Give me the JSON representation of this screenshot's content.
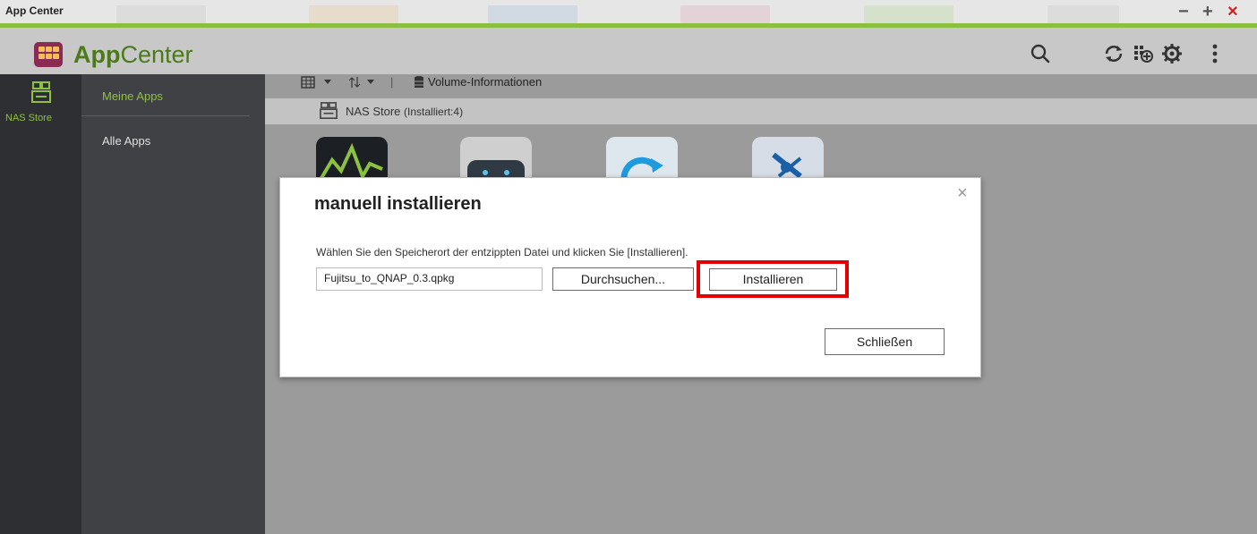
{
  "window": {
    "title": "App Center",
    "controls": {
      "minimize": "−",
      "maximize": "+",
      "close": "×"
    }
  },
  "header": {
    "app_title_bold": "App",
    "app_title_rest": "Center"
  },
  "rail": {
    "nas_store_label": "NAS Store"
  },
  "menu": {
    "items": [
      {
        "label": "Meine Apps",
        "active": true
      },
      {
        "label": "Alle Apps",
        "active": false
      }
    ]
  },
  "toolbar": {
    "volume_info": "Volume-Informationen",
    "separator": "|"
  },
  "section": {
    "title": "NAS Store",
    "count": "(Installiert:4)"
  },
  "dialog": {
    "title": "manuell installieren",
    "close": "×",
    "description": "Wählen Sie den Speicherort der entzippten Datei und klicken Sie [Installieren].",
    "file_value": "Fujitsu_to_QNAP_0.3.qpkg",
    "browse_label": "Durchsuchen...",
    "install_label": "Installieren",
    "close_label": "Schließen"
  },
  "colors": {
    "accent_green": "#8cc240",
    "title_green": "#4b7a1c",
    "highlight_red": "#e50000",
    "close_red": "#d42020"
  }
}
